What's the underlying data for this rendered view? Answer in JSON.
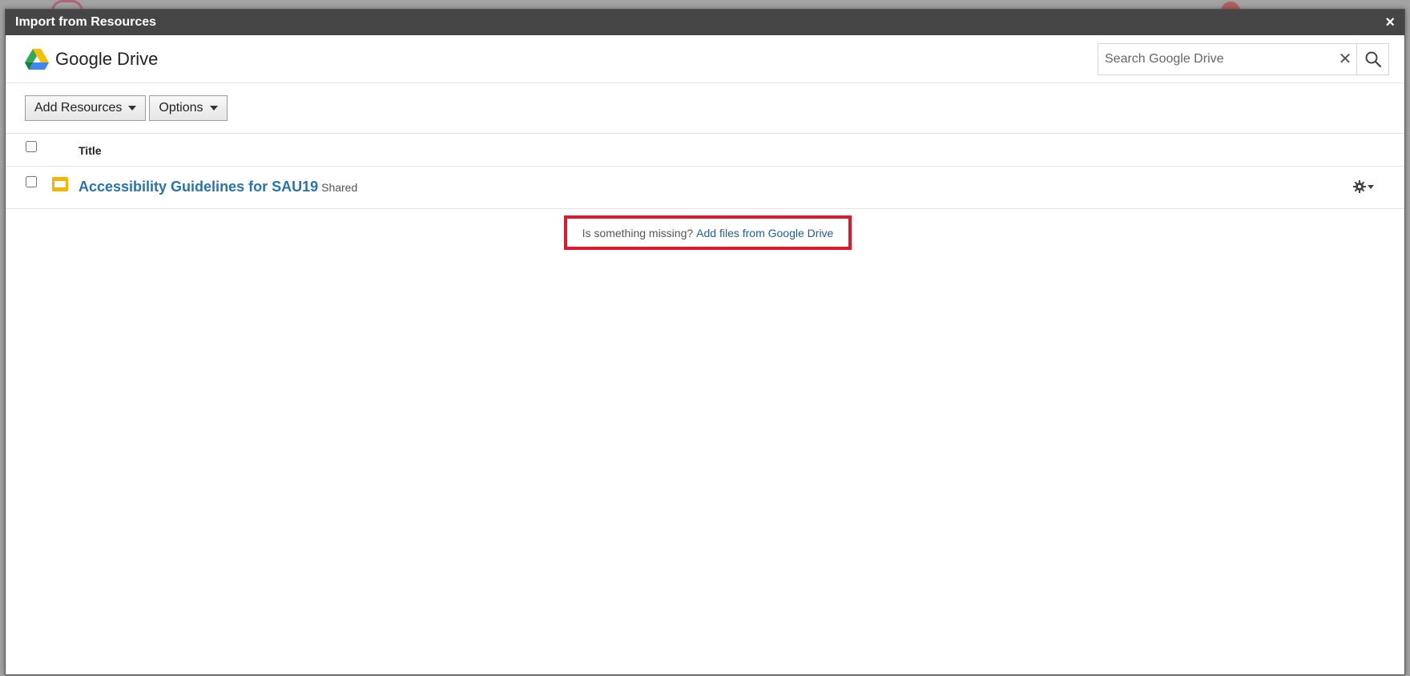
{
  "modal": {
    "title": "Import from Resources",
    "close_label": "×"
  },
  "drive": {
    "brand_name": "Google Drive",
    "search_placeholder": "Search Google Drive",
    "search_value": "",
    "search_clear_label": "✕"
  },
  "toolbar": {
    "add_resources_label": "Add Resources",
    "options_label": "Options"
  },
  "table": {
    "columns": [
      "Title"
    ],
    "rows": [
      {
        "title": "Accessibility Guidelines for SAU19",
        "badge": "Shared",
        "icon": "slides-file-icon"
      }
    ]
  },
  "footer": {
    "missing_text": "Is something missing?",
    "add_files_link": "Add files from Google Drive"
  },
  "colors": {
    "header_bg": "#454545",
    "link": "#2a72b0",
    "highlight_border": "#e0182b",
    "slides_icon": "#f4b400"
  }
}
